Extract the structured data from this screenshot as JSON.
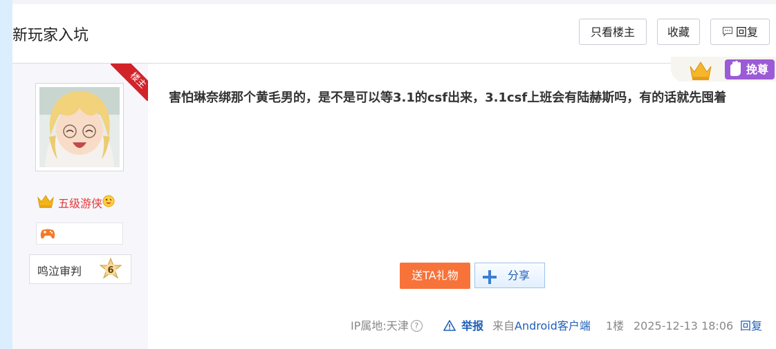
{
  "thread": {
    "title": "新玩家入坑"
  },
  "toolbar": {
    "only_owner_label": "只看楼主",
    "favorite_label": "收藏",
    "reply_label": "回复"
  },
  "author": {
    "owner_tag": "楼主",
    "level_title": "五级游侠",
    "medal_name": "鸣泣审判",
    "medal_level": "6",
    "promo_tag": "挽尊"
  },
  "post": {
    "content": "害怕琳奈绑那个黄毛男的，是不是可以等3.1的csf出来，3.1csf上班会有陆赫斯吗，有的话就先囤着"
  },
  "actions": {
    "gift_label": "送TA礼物",
    "share_label": "分享"
  },
  "meta": {
    "ip_label": "IP属地:天津",
    "report_label": "举报",
    "client_label": "来自Android客户端",
    "floor_label": "1楼",
    "timestamp": "2025-12-13 18:06",
    "reply_label": "回复"
  },
  "colors": {
    "accent_red": "#d2232a",
    "level_red": "#e33a3a",
    "gift_orange": "#f7733a",
    "link_blue": "#1f5fb6",
    "promo_purple": "#9c5bd6"
  },
  "icons": [
    "comment-icon",
    "crown-icon",
    "game-controller-icon",
    "hexagram-medal-icon",
    "plus-icon",
    "warning-icon",
    "question-icon",
    "hand-icon"
  ]
}
